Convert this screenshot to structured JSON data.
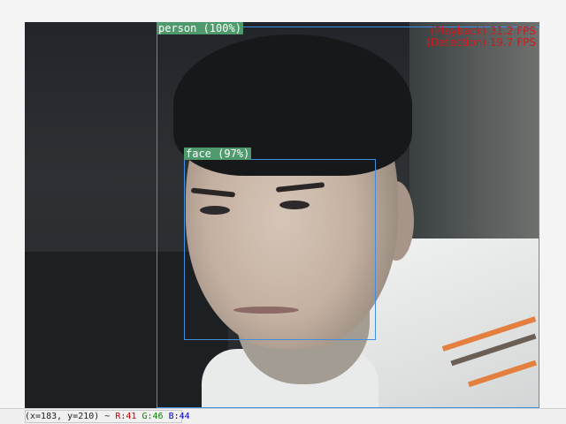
{
  "detections": {
    "person": {
      "label": "person (100%)"
    },
    "face": {
      "label": "face (97%)"
    }
  },
  "overlay": {
    "playback_fps": "(Playback) 31.2 FPS",
    "detection_fps": "(Detection) 19.7 FPS",
    "fps_color": "#d11a1a"
  },
  "status": {
    "coords": "(x=183, y=210) ~",
    "r": "R:41",
    "g": "G:46",
    "b": "B:44",
    "r_color": "#cc0000",
    "g_color": "#008800",
    "b_color": "#0000cc"
  },
  "colors": {
    "box": "#3f8ee0",
    "label_bg": "#4f9a6c"
  }
}
